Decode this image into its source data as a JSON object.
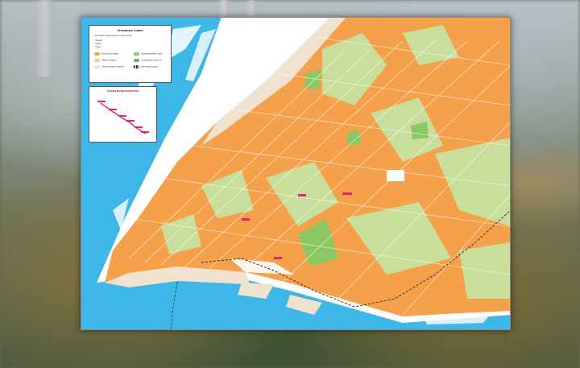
{
  "legend": {
    "title": "Условные знаки",
    "rows": [
      "Остановки общественного транспорта",
      "Музей",
      "Храм",
      "Театр",
      "Жилая застройка",
      "Парки и скверы",
      "Общественные здания",
      "Промышленные зоны",
      "Спортивные объекты",
      "Железная дорога"
    ]
  },
  "inset": {
    "title": "Схема метрополитена"
  },
  "colors": {
    "river": "#3fb6e8",
    "urban": "#f5a04a",
    "green": "#c9de9b",
    "park": "#8cc764",
    "beige": "#efe3cf",
    "metro": "#e0227a"
  }
}
